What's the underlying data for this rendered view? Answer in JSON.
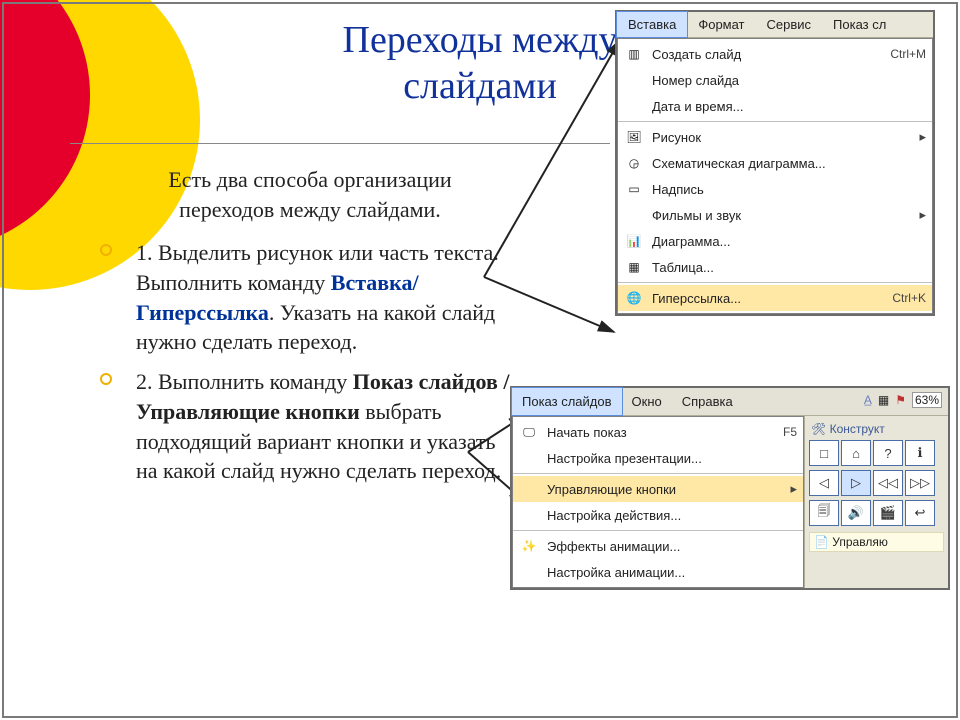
{
  "title_line1": "Переходы между",
  "title_line2": "слайдами",
  "intro_line1": "Есть два способа организации",
  "intro_line2": "переходов между слайдами.",
  "item1": {
    "t1": "1. Выделить рисунок или часть",
    "t2": "текста. Выполнить команду ",
    "bold": "Вставка/Гиперссылка",
    "t3": ". Указать на какой слайд нужно сделать переход."
  },
  "item2": {
    "t1": "2. Выполнить команду ",
    "bold": "Показ слайдов / Управляющие кнопки",
    "t2": " выбрать подходящий вариант кнопки и указать на какой слайд нужно сделать переход."
  },
  "menu1": {
    "tabs": [
      "Вставка",
      "Формат",
      "Сервис",
      "Показ сл"
    ],
    "active_tab": 0,
    "items": [
      {
        "icon": "▥",
        "label": "Создать слайд",
        "shortcut": "Ctrl+M"
      },
      {
        "icon": "",
        "label": "Номер слайда"
      },
      {
        "icon": "",
        "label": "Дата и время..."
      },
      {
        "divider": true
      },
      {
        "icon": "🖼",
        "label": "Рисунок",
        "arrow": true
      },
      {
        "icon": "◶",
        "label": "Схематическая диаграмма..."
      },
      {
        "icon": "▭",
        "label": "Надпись"
      },
      {
        "icon": "",
        "label": "Фильмы и звук",
        "arrow": true
      },
      {
        "icon": "📊",
        "label": "Диаграмма..."
      },
      {
        "icon": "▦",
        "label": "Таблица..."
      },
      {
        "divider": true
      },
      {
        "icon": "🌐",
        "label": "Гиперссылка...",
        "shortcut": "Ctrl+K",
        "highlight": true
      }
    ]
  },
  "menu2": {
    "tabs": [
      "Показ слайдов",
      "Окно",
      "Справка"
    ],
    "active_tab": 0,
    "zoom": "63%",
    "panel_title": "Конструкт",
    "panel_footer_icon": "📄",
    "panel_footer": "Управляю",
    "items": [
      {
        "icon": "🖵",
        "label": "Начать показ",
        "shortcut": "F5"
      },
      {
        "icon": "",
        "label": "Настройка презентации..."
      },
      {
        "divider": true
      },
      {
        "icon": "",
        "label": "Управляющие кнопки",
        "arrow": true,
        "highlight": true
      },
      {
        "icon": "",
        "label": "Настройка действия..."
      },
      {
        "divider": true
      },
      {
        "icon": "✨",
        "label": "Эффекты анимации..."
      },
      {
        "icon": "",
        "label": "Настройка анимации..."
      }
    ],
    "buttons": [
      "□",
      "⌂",
      "?",
      "ℹ",
      "◁",
      "▷",
      "◁◁",
      "▷▷",
      "🗐",
      "🔊",
      "🎬",
      "↩"
    ]
  }
}
